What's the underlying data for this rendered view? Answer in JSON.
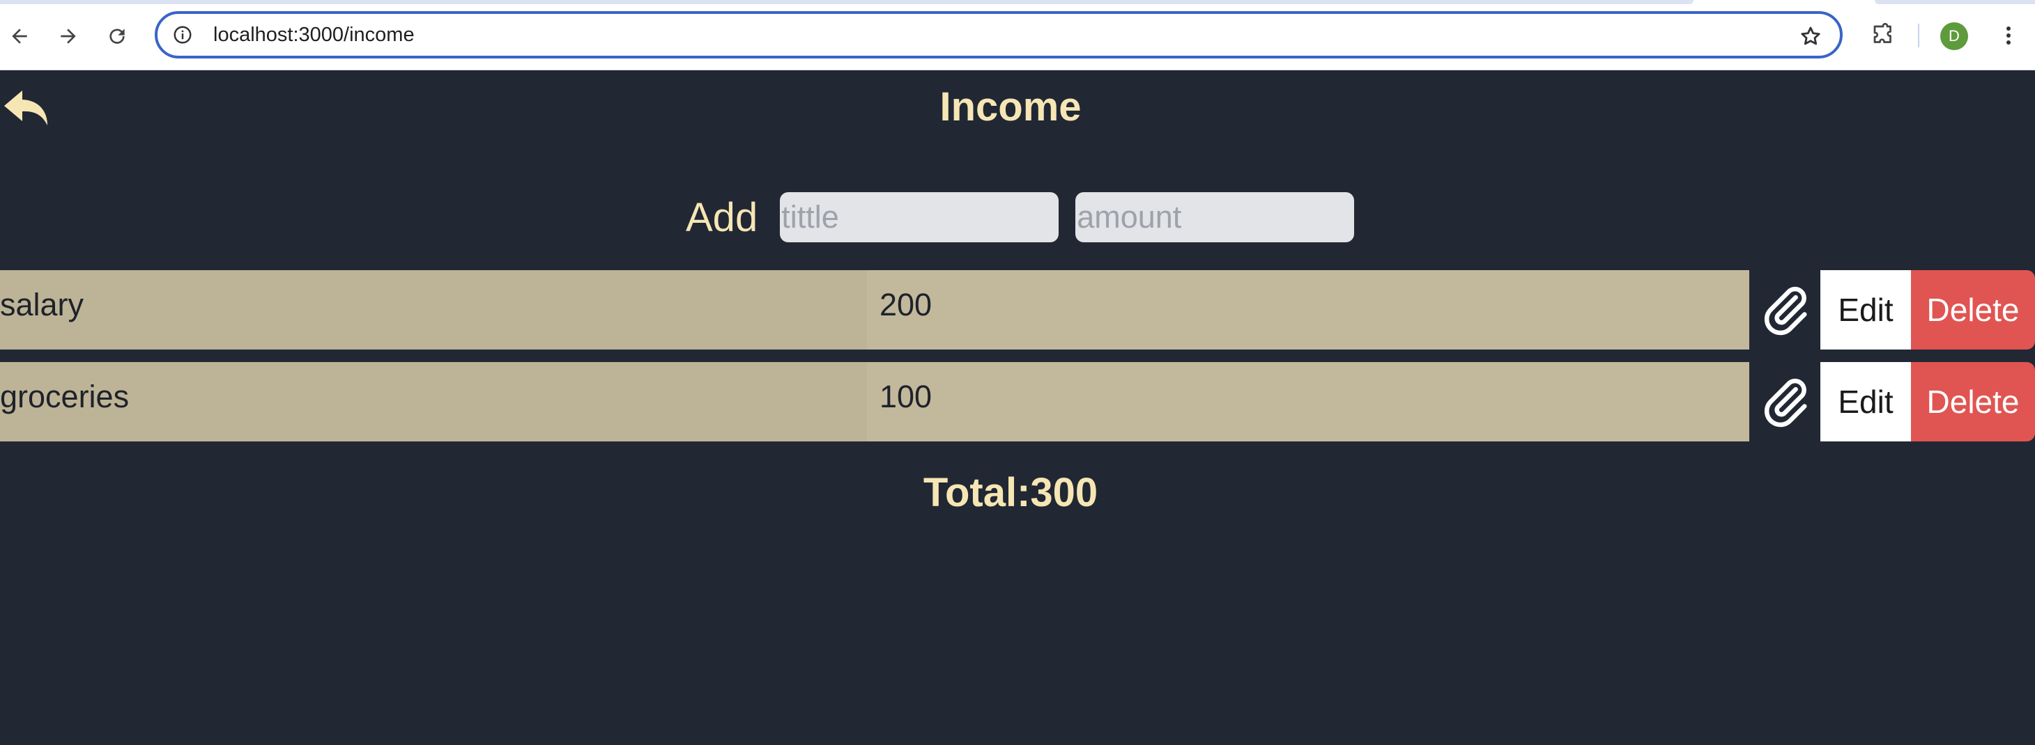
{
  "browser": {
    "url": "localhost:3000/income",
    "profile_initial": "D",
    "icons": {
      "back": "arrow-left-icon",
      "forward": "arrow-right-icon",
      "reload": "reload-icon",
      "site_info": "info-icon",
      "bookmark": "star-icon",
      "extensions": "puzzle-icon",
      "menu": "kebab-menu-icon"
    }
  },
  "page": {
    "title": "Income",
    "back_icon": "reply-arrow-icon"
  },
  "add_form": {
    "label": "Add",
    "title_placeholder": "tittle",
    "amount_placeholder": "amount"
  },
  "entries": [
    {
      "title": "salary",
      "amount": "200",
      "edit_label": "Edit",
      "delete_label": "Delete",
      "attach_icon": "paperclip-icon"
    },
    {
      "title": "groceries",
      "amount": "100",
      "edit_label": "Edit",
      "delete_label": "Delete",
      "attach_icon": "paperclip-icon"
    }
  ],
  "total": {
    "text": "Total:300"
  },
  "colors": {
    "background": "#222734",
    "accent_text": "#f5e6b4",
    "row_title_bg": "#bdb497",
    "row_amount_bg": "#c2b89b",
    "delete_bg": "#e05552",
    "omnibox_border": "#3a64c8"
  }
}
